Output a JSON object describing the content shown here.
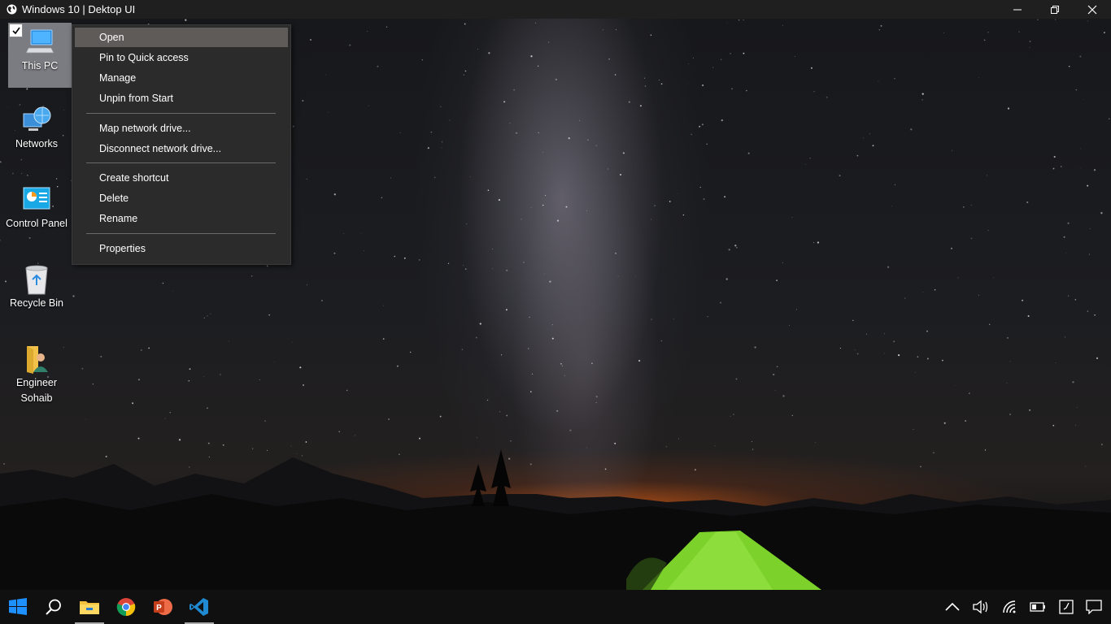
{
  "window": {
    "title": "Windows 10 | Dektop UI",
    "icon": "globe-icon",
    "controls": [
      "minimize",
      "restore",
      "close"
    ]
  },
  "desktop": {
    "icons": [
      {
        "label": "This PC",
        "icon": "computer-icon",
        "selected": true,
        "checked": true
      },
      {
        "label": "Networks",
        "icon": "network-icon"
      },
      {
        "label": "Control Panel",
        "icon": "control-panel-icon"
      },
      {
        "label": "Recycle Bin",
        "icon": "recycle-bin-icon"
      },
      {
        "label": "Engineer Sohaib",
        "icon": "user-folder-icon"
      }
    ]
  },
  "context_menu": {
    "groups": [
      [
        "Open",
        "Pin to Quick access",
        "Manage",
        "Unpin from Start"
      ],
      [
        "Map network drive...",
        "Disconnect network drive..."
      ],
      [
        "Create shortcut",
        "Delete",
        "Rename"
      ],
      [
        "Properties"
      ]
    ],
    "highlighted": "Open"
  },
  "taskbar": {
    "apps": [
      {
        "name": "start",
        "icon": "windows-logo-icon"
      },
      {
        "name": "search",
        "icon": "search-icon"
      },
      {
        "name": "file-explorer",
        "icon": "folder-icon",
        "running": true
      },
      {
        "name": "chrome",
        "icon": "chrome-icon"
      },
      {
        "name": "powerpoint",
        "icon": "powerpoint-icon"
      },
      {
        "name": "vscode",
        "icon": "vscode-icon",
        "running": true
      }
    ],
    "tray": [
      "chevron-up-icon",
      "volume-icon",
      "wifi-icon",
      "battery-icon",
      "clock-icon",
      "notification-icon"
    ]
  },
  "colors": {
    "menu_bg": "#2b2b2b",
    "menu_highlight": "#5e5b58",
    "taskbar_bg": "#101010",
    "accent_blue": "#1e90ff",
    "tent_green": "#7cd22a"
  }
}
